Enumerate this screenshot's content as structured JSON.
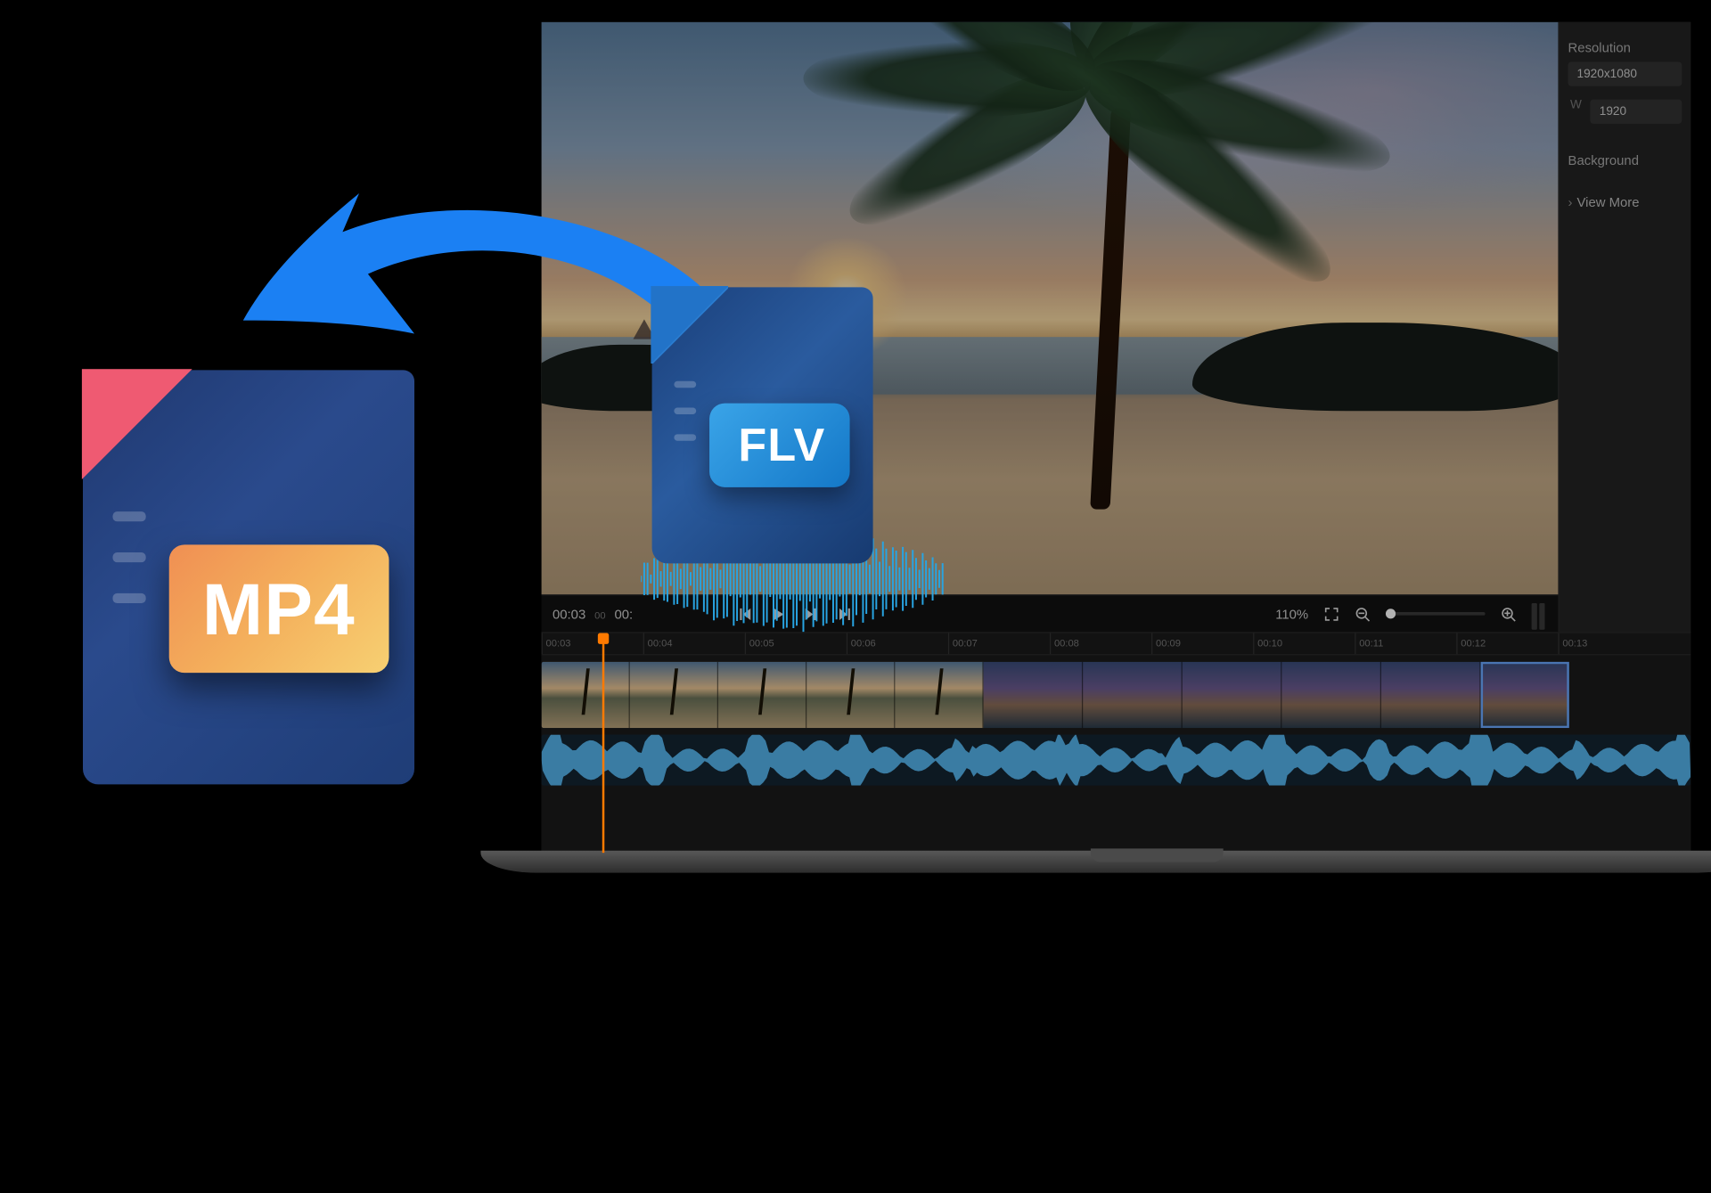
{
  "files": {
    "source_format": "FLV",
    "target_format": "MP4"
  },
  "editor": {
    "properties": {
      "resolution_label": "Resolution",
      "resolution_value": "1920x1080",
      "width_prefix": "W",
      "width_value": "1920",
      "background_label": "Background",
      "view_more": "View More"
    },
    "playbar": {
      "current_time": "00:03",
      "current_sub": "00",
      "secondary_time": "00:",
      "zoom_percent": "110%"
    },
    "timeline": {
      "ticks": [
        "00:03",
        "00:04",
        "00:05",
        "00:06",
        "00:07",
        "00:08",
        "00:09",
        "00:10",
        "00:11",
        "00:12",
        "00:13"
      ]
    }
  }
}
